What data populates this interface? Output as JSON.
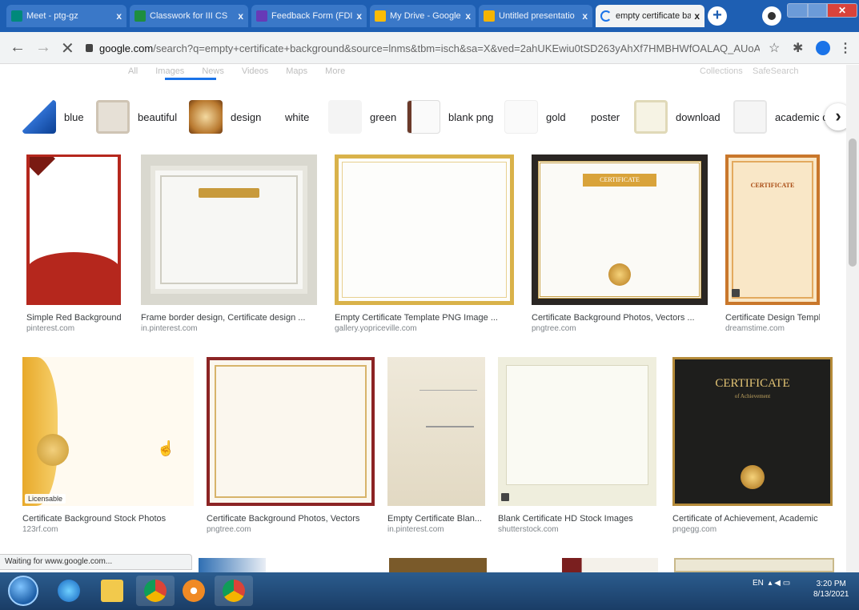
{
  "browser": {
    "tabs": [
      {
        "title": "Meet - ptg-gz",
        "color": "#00897b",
        "active": false
      },
      {
        "title": "Classwork for III CS",
        "color": "#1e8e3e",
        "active": false
      },
      {
        "title": "Feedback Form (FDI",
        "color": "#673ab7",
        "active": false
      },
      {
        "title": "My Drive - Google",
        "color": "#fbbc04",
        "active": false
      },
      {
        "title": "Untitled presentatio",
        "color": "#f4b400",
        "active": false
      },
      {
        "title": "empty certificate ba",
        "color": "#1a73e8",
        "active": true
      }
    ],
    "new_tab": "+",
    "close_glyph": "x",
    "url_host": "google.com",
    "url_path": "/search?q=empty+certificate+background&source=lnms&tbm=isch&sa=X&ved=2ahUKEwiu0tSD263yAhXf7HMBHWfOALAQ_AUoAXoECAEQAw..."
  },
  "search_tabs": [
    "All",
    "Images",
    "News",
    "Videos",
    "Maps",
    "More"
  ],
  "tools": [
    "Collections",
    "SafeSearch"
  ],
  "chips": [
    {
      "label": "blue",
      "color": "#2e6fd1"
    },
    {
      "label": "beautiful",
      "color": "#e6e0d6"
    },
    {
      "label": "design",
      "color": "#b8782e"
    },
    {
      "label": "white",
      "color": "#ffffff"
    },
    {
      "label": "green",
      "color": "#f4f4f4"
    },
    {
      "label": "blank png",
      "color": "#6b3a2a"
    },
    {
      "label": "gold",
      "color": "#fafafa"
    },
    {
      "label": "poster",
      "color": "#ffffff"
    },
    {
      "label": "download",
      "color": "#e8e4c8"
    },
    {
      "label": "academic c",
      "color": "#eeeeee"
    }
  ],
  "results_row1": [
    {
      "caption": "Simple Red Background ...",
      "source": "pinterest.com"
    },
    {
      "caption": "Frame border design, Certificate design ...",
      "source": "in.pinterest.com"
    },
    {
      "caption": "Empty Certificate Template PNG Image ...",
      "source": "gallery.yopriceville.com"
    },
    {
      "caption": "Certificate Background Photos, Vectors ...",
      "source": "pngtree.com"
    },
    {
      "caption": "Certificate Design Templat...",
      "source": "dreamstime.com"
    }
  ],
  "results_row2": [
    {
      "caption": "Certificate Background Stock Photos",
      "source": "123rf.com",
      "badge": "Licensable"
    },
    {
      "caption": "Certificate Background Photos, Vectors",
      "source": "pngtree.com"
    },
    {
      "caption": "Empty Certificate Blan...",
      "source": "in.pinterest.com"
    },
    {
      "caption": "Blank Certificate HD Stock Images",
      "source": "shutterstock.com"
    },
    {
      "caption": "Certificate of Achievement, Academic",
      "source": "pngegg.com"
    }
  ],
  "image_text": {
    "certificate_small": "CERTIFICATE",
    "certificate_gold": "CERTIFICATE",
    "certificate_dark": "CERTIFICATE",
    "certificate_dark_sub": "of Achievement"
  },
  "status_text": "Waiting for www.google.com...",
  "taskbar": {
    "language": "EN",
    "time": "3:20 PM",
    "date": "8/13/2021"
  }
}
